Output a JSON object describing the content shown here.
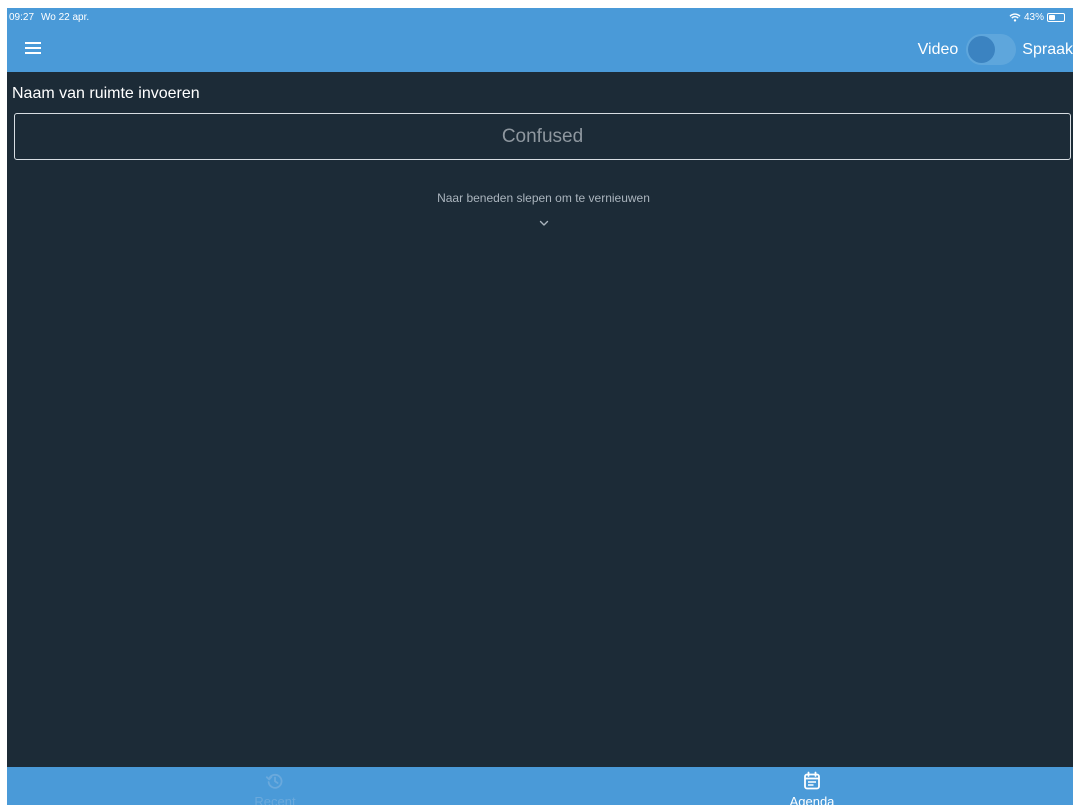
{
  "status_bar": {
    "time": "09:27",
    "date": "Wo 22 apr.",
    "battery": "43%",
    "battery_level": 0.43,
    "icons": [
      "wifi-icon",
      "battery-icon"
    ]
  },
  "nav_bar": {
    "menu_icon": "hamburger-menu-icon",
    "video_label": "Video",
    "spraak_label": "Spraak",
    "toggle_on": false
  },
  "room": {
    "label": "Naam van ruimte invoeren",
    "placeholder": "Confused",
    "value": ""
  },
  "pull_to_refresh": {
    "text": "Naar beneden slepen om te vernieuwen",
    "icon": "chevron-down-icon"
  },
  "tabs": [
    {
      "label": "Recent",
      "icon": "history-icon",
      "active": false
    },
    {
      "label": "Agenda",
      "icon": "calendar-icon",
      "active": true
    }
  ],
  "colors": {
    "bar_blue": "#4a9ad8",
    "background": "#1c2b37",
    "inactive_tab": "#6aa9dc",
    "active_tab": "#ffffff"
  }
}
